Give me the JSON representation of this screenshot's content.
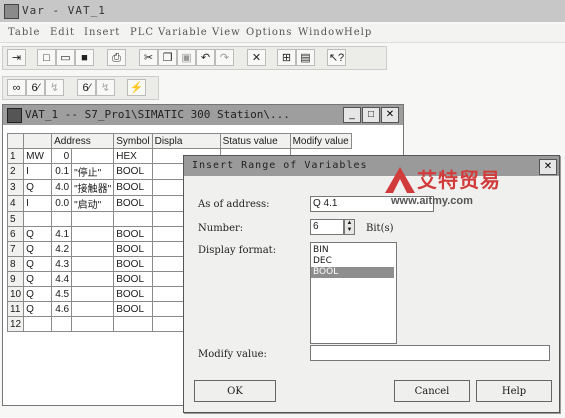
{
  "app": {
    "title": "Var - VAT_1"
  },
  "menu": [
    "Table",
    "Edit",
    "Insert",
    "PLC",
    "Variable",
    "View",
    "Options",
    "Window",
    "Help"
  ],
  "table_window": {
    "title": "VAT_1 -- S7_Pro1\\SIMATIC 300 Station\\...",
    "columns": [
      "",
      "Address",
      "Symbol",
      "Displa",
      "Status value",
      "Modify value"
    ],
    "rows": [
      {
        "n": "1",
        "t": "MW",
        "a": "0",
        "s": "",
        "d": "HEX"
      },
      {
        "n": "2",
        "t": "I",
        "a": "0.1",
        "s": "\"停止\"",
        "d": "BOOL"
      },
      {
        "n": "3",
        "t": "Q",
        "a": "4.0",
        "s": "\"接触器\"",
        "d": "BOOL"
      },
      {
        "n": "4",
        "t": "I",
        "a": "0.0",
        "s": "\"启动\"",
        "d": "BOOL"
      },
      {
        "n": "5",
        "t": "",
        "a": "",
        "s": "",
        "d": ""
      },
      {
        "n": "6",
        "t": "Q",
        "a": "4.1",
        "s": "",
        "d": "BOOL"
      },
      {
        "n": "7",
        "t": "Q",
        "a": "4.2",
        "s": "",
        "d": "BOOL"
      },
      {
        "n": "8",
        "t": "Q",
        "a": "4.3",
        "s": "",
        "d": "BOOL"
      },
      {
        "n": "9",
        "t": "Q",
        "a": "4.4",
        "s": "",
        "d": "BOOL"
      },
      {
        "n": "10",
        "t": "Q",
        "a": "4.5",
        "s": "",
        "d": "BOOL"
      },
      {
        "n": "11",
        "t": "Q",
        "a": "4.6",
        "s": "",
        "d": "BOOL"
      },
      {
        "n": "12",
        "t": "",
        "a": "",
        "s": "",
        "d": ""
      }
    ]
  },
  "dialog": {
    "title": "Insert Range of Variables",
    "as_of_address_label": "As of address:",
    "as_of_address_value": "Q 4.1",
    "number_label": "Number:",
    "number_value": "6",
    "bits_label": "Bit(s)",
    "display_format_label": "Display format:",
    "formats": [
      "BIN",
      "DEC",
      "BOOL"
    ],
    "selected_format": "BOOL",
    "modify_value_label": "Modify value:",
    "modify_value": "",
    "ok": "OK",
    "cancel": "Cancel",
    "help": "Help"
  },
  "watermark": {
    "brand": "艾特贸易",
    "url": "www.aitmy.com"
  },
  "colors": {
    "titlebar": "#9a9a9a",
    "selection": "#8e8e8e",
    "watermark_red": "#d23b3b"
  }
}
